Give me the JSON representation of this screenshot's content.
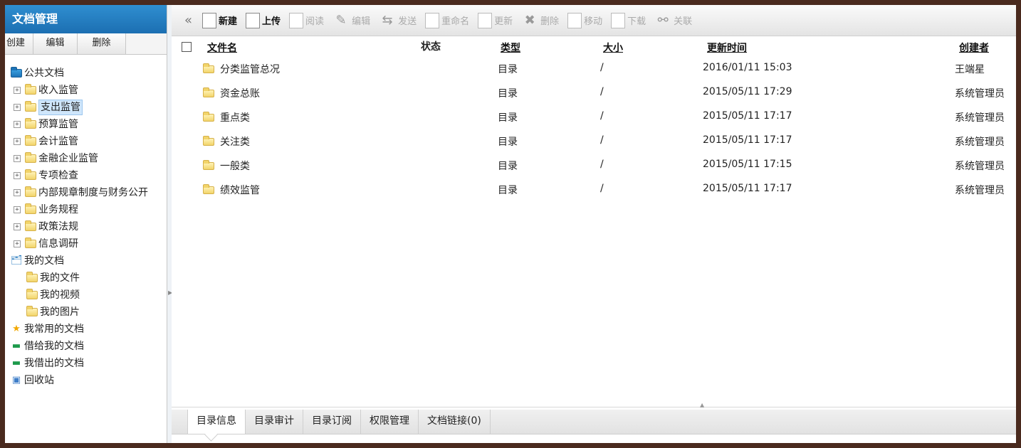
{
  "sidebar": {
    "title": "文档管理",
    "buttons": [
      "创建",
      "编辑",
      "删除"
    ],
    "tree": [
      {
        "label": "公共文档",
        "level": 0,
        "icon": "blue-folder-icon"
      },
      {
        "label": "收入监管",
        "level": 1,
        "expandable": true
      },
      {
        "label": "支出监管",
        "level": 1,
        "expandable": true,
        "selected": true
      },
      {
        "label": "预算监管",
        "level": 1,
        "expandable": true
      },
      {
        "label": "会计监管",
        "level": 1,
        "expandable": true
      },
      {
        "label": "金融企业监管",
        "level": 1,
        "expandable": true
      },
      {
        "label": "专项检查",
        "level": 1,
        "expandable": true
      },
      {
        "label": "内部规章制度与财务公开",
        "level": 1,
        "expandable": true
      },
      {
        "label": "业务规程",
        "level": 1,
        "expandable": true
      },
      {
        "label": "政策法规",
        "level": 1,
        "expandable": true
      },
      {
        "label": "信息调研",
        "level": 1,
        "expandable": true
      },
      {
        "label": "我的文档",
        "level": 0,
        "icon": "my-docs-icon"
      },
      {
        "label": "我的文件",
        "level": 1,
        "expandable": false
      },
      {
        "label": "我的视频",
        "level": 1,
        "expandable": false
      },
      {
        "label": "我的图片",
        "level": 1,
        "expandable": false
      },
      {
        "label": "我常用的文档",
        "level": 0,
        "icon": "star-icon"
      },
      {
        "label": "借给我的文档",
        "level": 0,
        "icon": "inbox-icon"
      },
      {
        "label": "我借出的文档",
        "level": 0,
        "icon": "outbox-icon"
      },
      {
        "label": "回收站",
        "level": 0,
        "icon": "recycle-bin-icon"
      }
    ]
  },
  "toolbar": {
    "collapse_glyph": "«",
    "buttons": [
      {
        "label": "新建",
        "enabled": true,
        "icon": "new-doc-icon"
      },
      {
        "label": "上传",
        "enabled": true,
        "icon": "upload-icon"
      },
      {
        "label": "阅读",
        "enabled": false,
        "icon": "read-icon"
      },
      {
        "label": "编辑",
        "enabled": false,
        "icon": "pencil-icon"
      },
      {
        "label": "发送",
        "enabled": false,
        "icon": "send-icon"
      },
      {
        "label": "重命名",
        "enabled": false,
        "icon": "rename-icon"
      },
      {
        "label": "更新",
        "enabled": false,
        "icon": "update-icon"
      },
      {
        "label": "删除",
        "enabled": false,
        "icon": "delete-icon"
      },
      {
        "label": "移动",
        "enabled": false,
        "icon": "move-icon"
      },
      {
        "label": "下载",
        "enabled": false,
        "icon": "download-icon"
      },
      {
        "label": "关联",
        "enabled": false,
        "icon": "link-icon"
      }
    ]
  },
  "grid": {
    "columns": {
      "name": "文件名",
      "status": "状态",
      "type": "类型",
      "size": "大小",
      "updated": "更新时间",
      "creator": "创建者"
    },
    "rows": [
      {
        "name": "分类监管总况",
        "status": "",
        "type": "目录",
        "size": "/",
        "updated": "2016/01/11 15:03",
        "creator": "王端星"
      },
      {
        "name": "资金总账",
        "status": "",
        "type": "目录",
        "size": "/",
        "updated": "2015/05/11 17:29",
        "creator": "系统管理员"
      },
      {
        "name": "重点类",
        "status": "",
        "type": "目录",
        "size": "/",
        "updated": "2015/05/11 17:17",
        "creator": "系统管理员"
      },
      {
        "name": "关注类",
        "status": "",
        "type": "目录",
        "size": "/",
        "updated": "2015/05/11 17:17",
        "creator": "系统管理员"
      },
      {
        "name": "一般类",
        "status": "",
        "type": "目录",
        "size": "/",
        "updated": "2015/05/11 17:15",
        "creator": "系统管理员"
      },
      {
        "name": "绩效监管",
        "status": "",
        "type": "目录",
        "size": "/",
        "updated": "2015/05/11 17:17",
        "creator": "系统管理员"
      }
    ]
  },
  "tabs": [
    {
      "label": "目录信息",
      "active": true
    },
    {
      "label": "目录审计",
      "active": false
    },
    {
      "label": "目录订阅",
      "active": false
    },
    {
      "label": "权限管理",
      "active": false
    },
    {
      "label": "文档链接(0)",
      "active": false
    }
  ],
  "colors": {
    "frame_border": "#4a2a1e",
    "sidebar_title_bg": "#1c6fb2",
    "selected_bg": "#cfe6fb"
  }
}
